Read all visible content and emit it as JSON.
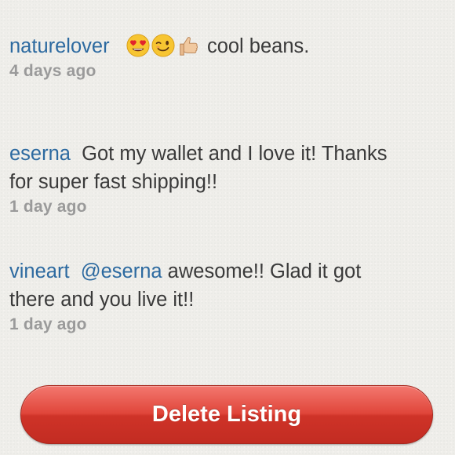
{
  "comments": [
    {
      "user": "naturelover",
      "emojis": [
        "heart-eyes-emoji-icon",
        "wink-emoji-icon",
        "thumbs-up-emoji-icon"
      ],
      "text": "cool beans.",
      "time": "4 days ago"
    },
    {
      "user": "eserna",
      "text_line1": "Got my wallet and I love it! Thanks",
      "text_line2": "for super fast shipping!!",
      "time": "1 day ago"
    },
    {
      "user": "vineart",
      "mention": "@eserna",
      "text_line1": "awesome!!  Glad it got",
      "text_line2": "there and you live it!!",
      "time": "1 day ago"
    }
  ],
  "delete_button": {
    "label": "Delete Listing",
    "color": "#e0453a"
  },
  "colors": {
    "username": "#2d6aa0",
    "body_text": "#3a3a3a",
    "timestamp": "#9a9a9a",
    "background": "#efeeea"
  }
}
